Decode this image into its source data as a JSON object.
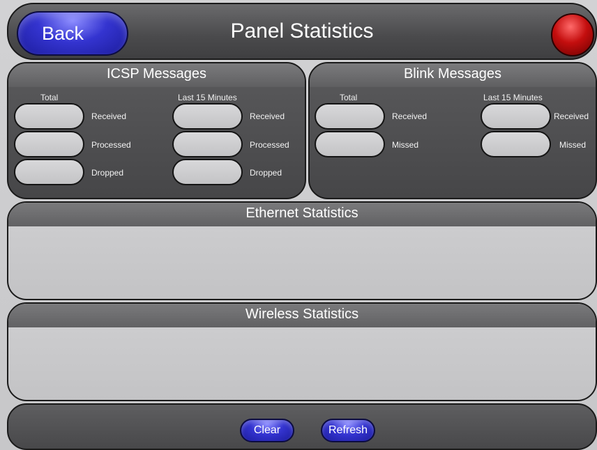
{
  "header": {
    "back_label": "Back",
    "title": "Panel Statistics"
  },
  "icsp": {
    "title": "ICSP Messages",
    "total_label": "Total",
    "last15_label": "Last 15 Minutes",
    "rows": [
      "Received",
      "Processed",
      "Dropped"
    ]
  },
  "blink": {
    "title": "Blink Messages",
    "total_label": "Total",
    "last15_label": "Last 15 Minutes",
    "rows": [
      "Received",
      "Missed"
    ]
  },
  "ethernet": {
    "title": "Ethernet Statistics"
  },
  "wireless": {
    "title": "Wireless Statistics"
  },
  "footer": {
    "clear_label": "Clear",
    "refresh_label": "Refresh"
  },
  "colors": {
    "button_blue": "#3434d0",
    "status_red": "#c40e0e",
    "panel_dark": "#4a4a4c"
  }
}
